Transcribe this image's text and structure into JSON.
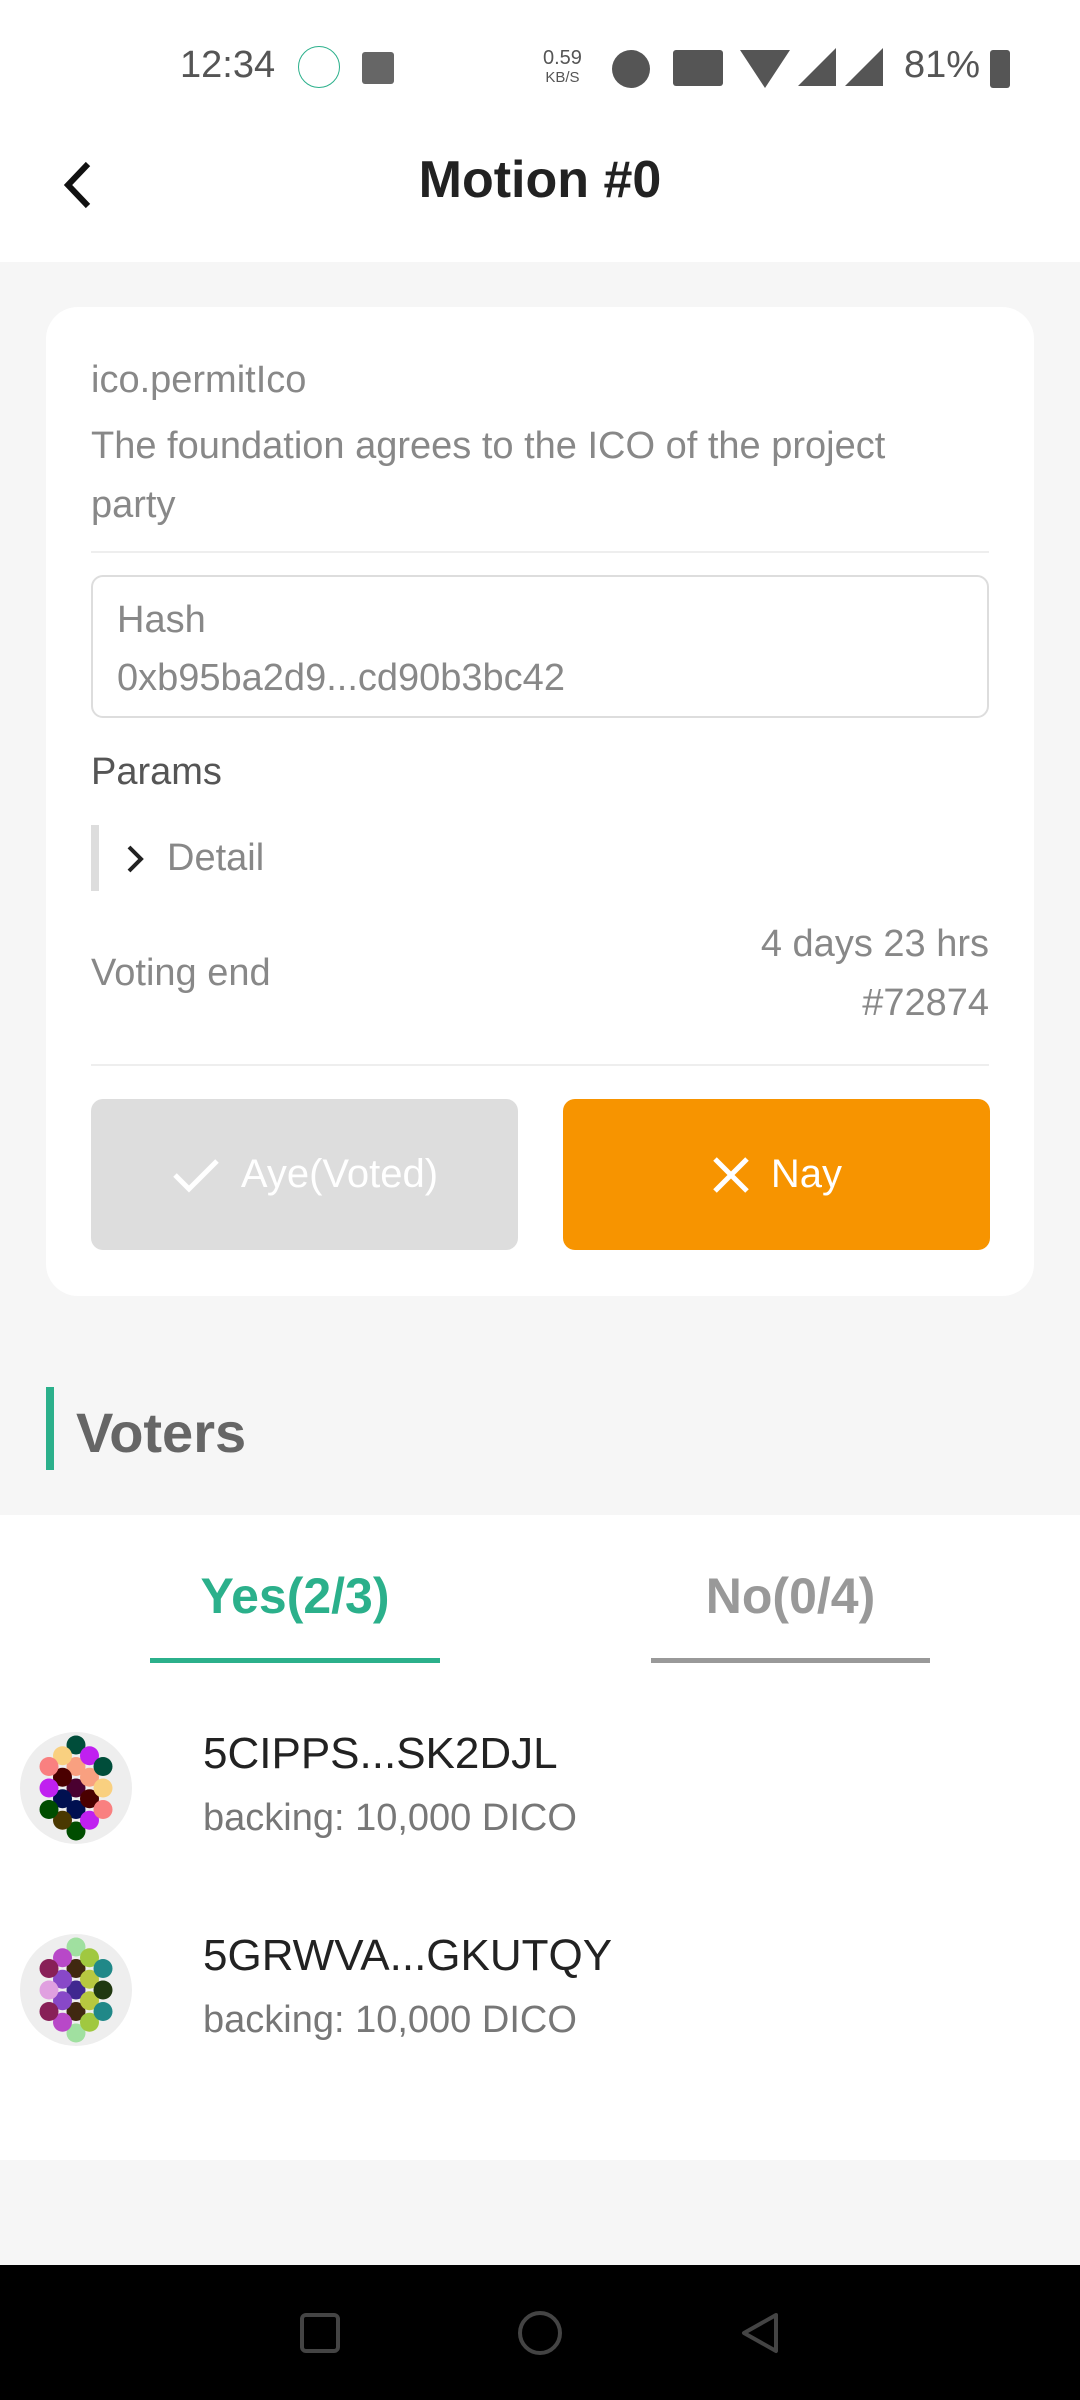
{
  "status_bar": {
    "time": "12:34",
    "net_speed": "0.59",
    "net_unit": "KB/S",
    "network": "4G",
    "battery": "81%"
  },
  "header": {
    "title": "Motion #0"
  },
  "motion": {
    "method": "ico.permitIco",
    "description": "The foundation agrees to the ICO of the project party",
    "hash_label": "Hash",
    "hash_value": "0xb95ba2d9...cd90b3bc42",
    "params_label": "Params",
    "detail_label": "Detail",
    "voting_end_label": "Voting end",
    "voting_end_time": "4 days 23 hrs",
    "voting_end_block": "#72874",
    "aye_label": "Aye(Voted)",
    "nay_label": "Nay"
  },
  "voters": {
    "title": "Voters",
    "tabs": [
      {
        "label": "Yes(2/3)",
        "active": true
      },
      {
        "label": "No(0/4)",
        "active": false
      }
    ],
    "items": [
      {
        "name": "5CIPPS...SK2DJL",
        "backing": "backing: 10,000 DICO",
        "colors": [
          "#004d3a",
          "#f9a080",
          "#4a0030",
          "#001050",
          "#004d00",
          "#f9d080",
          "#4a0000",
          "#001050",
          "#4a3800",
          "#c020f0",
          "#f9a080",
          "#4a0000",
          "#c020f0",
          "#f98080",
          "#c020f0",
          "#004d00",
          "#004d3a",
          "#f9d080",
          "#f98080"
        ]
      },
      {
        "name": "5GRWVA...GKUTQY",
        "backing": "backing: 10,000 DICO",
        "colors": [
          "#a0e0a0",
          "#402810",
          "#402890",
          "#402810",
          "#a0e0a0",
          "#b848c8",
          "#8848c8",
          "#8848c8",
          "#b848c8",
          "#a0c840",
          "#b8c840",
          "#b8c840",
          "#a0c840",
          "#882058",
          "#e0a0e0",
          "#882058",
          "#208888",
          "#203810",
          "#208888"
        ]
      }
    ]
  },
  "colors": {
    "accent": "#2bb08b",
    "nay": "#f79400",
    "aye_disabled": "#dddddd"
  }
}
